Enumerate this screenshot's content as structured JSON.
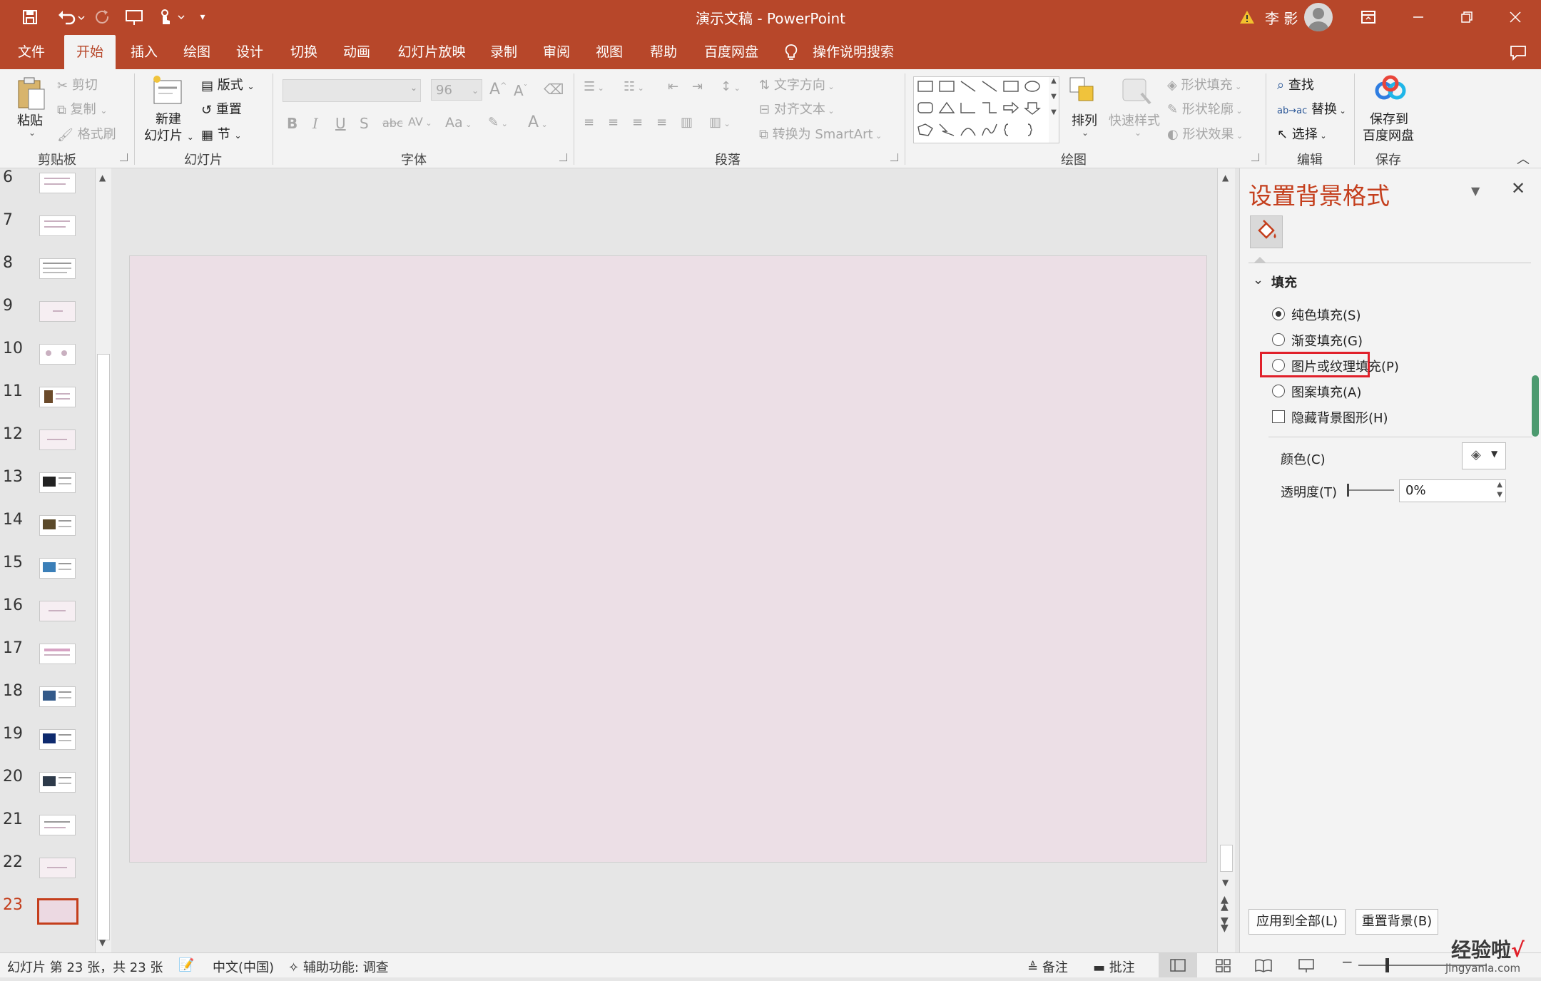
{
  "app": {
    "document_title": "演示文稿",
    "separator": "-",
    "app_name": "PowerPoint",
    "user_name": "李 影"
  },
  "tabs": [
    "文件",
    "开始",
    "插入",
    "绘图",
    "设计",
    "切换",
    "动画",
    "幻灯片放映",
    "录制",
    "审阅",
    "视图",
    "帮助",
    "百度网盘"
  ],
  "active_tab": "开始",
  "tell_me": "操作说明搜索",
  "ribbon": {
    "clipboard": {
      "paste": "粘贴",
      "cut": "剪切",
      "copy": "复制",
      "format_painter": "格式刷",
      "label": "剪贴板"
    },
    "slides": {
      "new_slide_1": "新建",
      "new_slide_2": "幻灯片",
      "layout": "版式",
      "reset": "重置",
      "section": "节",
      "label": "幻灯片"
    },
    "font": {
      "font_name": "",
      "font_size": "96",
      "label": "字体",
      "bold": "B",
      "italic": "I",
      "underline": "U",
      "shadow": "S",
      "strike": "abc",
      "spacing": "AV",
      "case": "Aa",
      "color": "A"
    },
    "paragraph": {
      "text_direction": "文字方向",
      "align_text": "对齐文本",
      "smartart": "转换为 SmartArt",
      "label": "段落"
    },
    "drawing": {
      "arrange": "排列",
      "quick_styles": "快速样式",
      "shape_fill": "形状填充",
      "shape_outline": "形状轮廓",
      "shape_effects": "形状效果",
      "label": "绘图"
    },
    "editing": {
      "find": "查找",
      "replace": "替换",
      "select": "选择",
      "label": "编辑"
    },
    "save": {
      "save_to_1": "保存到",
      "save_to_2": "百度网盘",
      "label": "保存"
    }
  },
  "thumbnails": {
    "numbers": [
      "6",
      "7",
      "8",
      "9",
      "10",
      "11",
      "12",
      "13",
      "14",
      "15",
      "16",
      "17",
      "18",
      "19",
      "20",
      "21",
      "22",
      "23"
    ],
    "current": "23"
  },
  "format_pane": {
    "title": "设置背景格式",
    "section_fill": "填充",
    "options": [
      "纯色填充(S)",
      "渐变填充(G)",
      "图片或纹理填充(P)",
      "图案填充(A)"
    ],
    "selected_option": "纯色填充(S)",
    "highlighted_option": "图片或纹理填充(P)",
    "hide_bg_graphics": "隐藏背景图形(H)",
    "hide_bg_graphics_checked": false,
    "color_label": "颜色(C)",
    "transparency_label": "透明度(T)",
    "transparency_value": "0%",
    "apply_all": "应用到全部(L)",
    "reset_bg": "重置背景(B)",
    "highlight_color": "#e0202a"
  },
  "status": {
    "slide_info": "幻灯片 第 23 张，共 23 张",
    "language": "中文(中国)",
    "accessibility": "辅助功能: 调查",
    "notes": "备注",
    "comments": "批注"
  },
  "watermark": "经验啦",
  "watermark_url": "jingyanla.com",
  "colors": {
    "accent": "#b7472a",
    "pane_title": "#c43e1c",
    "slide_bg": "#ecdfe6"
  }
}
